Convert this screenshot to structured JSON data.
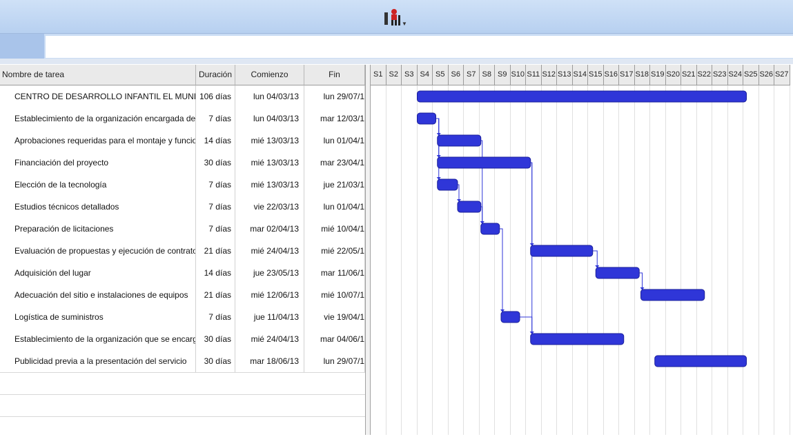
{
  "toolbar": {
    "icon": "resource-usage-icon"
  },
  "entry_bar": {
    "value": ""
  },
  "columns": {
    "name": "Nombre de tarea",
    "duration": "Duración",
    "start": "Comienzo",
    "end": "Fin"
  },
  "tasks": [
    {
      "name": "CENTRO DE DESARROLLO INFANTIL EL MUNDO DE L(",
      "duration": "106 días",
      "start": "lun 04/03/13",
      "end": "lun 29/07/1"
    },
    {
      "name": "Establecimiento de la organización encargada de la eje",
      "duration": "7 días",
      "start": "lun 04/03/13",
      "end": "mar 12/03/1"
    },
    {
      "name": "Aprobaciones requeridas para el montaje y funcionam",
      "duration": "14 días",
      "start": "mié 13/03/13",
      "end": "lun 01/04/1"
    },
    {
      "name": "Financiación del proyecto",
      "duration": "30 días",
      "start": "mié 13/03/13",
      "end": "mar 23/04/1"
    },
    {
      "name": "Elección de la tecnología",
      "duration": "7 días",
      "start": "mié 13/03/13",
      "end": "jue 21/03/1"
    },
    {
      "name": "Estudios técnicos detallados",
      "duration": "7 días",
      "start": "vie 22/03/13",
      "end": "lun 01/04/1"
    },
    {
      "name": "Preparación de licitaciones",
      "duration": "7 días",
      "start": "mar 02/04/13",
      "end": "mié 10/04/1"
    },
    {
      "name": "Evaluación de propuestas y ejecución de contratos",
      "duration": "21 días",
      "start": "mié 24/04/13",
      "end": "mié 22/05/1"
    },
    {
      "name": "Adquisición del lugar",
      "duration": "14 días",
      "start": "jue 23/05/13",
      "end": "mar 11/06/1"
    },
    {
      "name": "Adecuación del sitio e instalaciones de equipos",
      "duration": "21 días",
      "start": "mié 12/06/13",
      "end": "mié 10/07/1"
    },
    {
      "name": "Logística de suministros",
      "duration": "7 días",
      "start": "jue 11/04/13",
      "end": "vie 19/04/1"
    },
    {
      "name": "Establecimiento de la organización que se encargará (",
      "duration": "30 días",
      "start": "mié 24/04/13",
      "end": "mar 04/06/1"
    },
    {
      "name": "Publicidad previa a la presentación del servicio",
      "duration": "30 días",
      "start": "mar 18/06/13",
      "end": "lun 29/07/1"
    }
  ],
  "weeks": [
    "S1",
    "S2",
    "S3",
    "S4",
    "S5",
    "S6",
    "S7",
    "S8",
    "S9",
    "S10",
    "S11",
    "S12",
    "S13",
    "S14",
    "S15",
    "S16",
    "S17",
    "S18",
    "S19",
    "S20",
    "S21",
    "S22",
    "S23",
    "S24",
    "S25",
    "S26",
    "S27"
  ],
  "chart_data": {
    "type": "gantt",
    "timescale_unit": "week",
    "bars": [
      {
        "task": 0,
        "start_week": 4.0,
        "end_week": 25.2
      },
      {
        "task": 1,
        "start_week": 4.0,
        "end_week": 5.2
      },
      {
        "task": 2,
        "start_week": 5.3,
        "end_week": 8.1
      },
      {
        "task": 3,
        "start_week": 5.3,
        "end_week": 11.3
      },
      {
        "task": 4,
        "start_week": 5.3,
        "end_week": 6.6
      },
      {
        "task": 5,
        "start_week": 6.6,
        "end_week": 8.1
      },
      {
        "task": 6,
        "start_week": 8.1,
        "end_week": 9.3
      },
      {
        "task": 7,
        "start_week": 11.3,
        "end_week": 15.3
      },
      {
        "task": 8,
        "start_week": 15.5,
        "end_week": 18.3
      },
      {
        "task": 9,
        "start_week": 18.4,
        "end_week": 22.5
      },
      {
        "task": 10,
        "start_week": 9.4,
        "end_week": 10.6
      },
      {
        "task": 11,
        "start_week": 11.3,
        "end_week": 17.3
      },
      {
        "task": 12,
        "start_week": 19.3,
        "end_week": 25.2
      }
    ],
    "links": [
      [
        1,
        2
      ],
      [
        1,
        3
      ],
      [
        1,
        4
      ],
      [
        4,
        5
      ],
      [
        5,
        6
      ],
      [
        2,
        6
      ],
      [
        3,
        7
      ],
      [
        7,
        8
      ],
      [
        8,
        9
      ],
      [
        6,
        10
      ],
      [
        10,
        11
      ],
      [
        3,
        11
      ]
    ],
    "bar_color": "#2f36d8"
  }
}
